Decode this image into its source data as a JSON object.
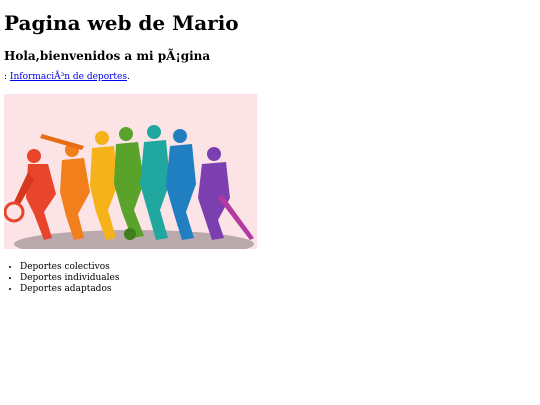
{
  "page": {
    "title": "Pagina web de Mario",
    "subtitle": "Hola,bienvenidos a mi pÃ¡gina",
    "link_prefix": ": ",
    "link_text": "InformaciÃ³n de deportes",
    "link_suffix": "."
  },
  "image": {
    "subject": "silhouettes of athletes in rainbow colors",
    "colors": [
      "#e8452c",
      "#f07f1c",
      "#f6b21b",
      "#5aa32a",
      "#1fa7a0",
      "#1f7fc0",
      "#7b3fb0",
      "#b23aa0"
    ]
  },
  "list": {
    "items": [
      "Deportes colectivos",
      "Deportes individuales",
      "Deportes adaptados"
    ]
  }
}
